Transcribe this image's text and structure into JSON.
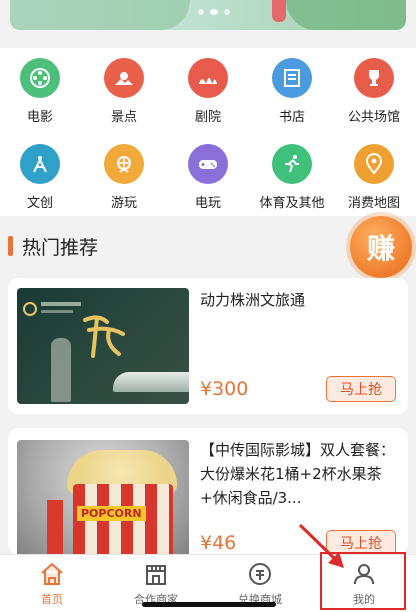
{
  "banner": {
    "page_dots": 3,
    "active_dot": 1
  },
  "categories": [
    {
      "label": "电影",
      "icon": "film-reel-icon",
      "color": "#4cc07a"
    },
    {
      "label": "景点",
      "icon": "sun-landscape-icon",
      "color": "#e8604a"
    },
    {
      "label": "剧院",
      "icon": "opera-house-icon",
      "color": "#e75a4c"
    },
    {
      "label": "书店",
      "icon": "bookstore-icon",
      "color": "#4a9be0"
    },
    {
      "label": "公共场馆",
      "icon": "trophy-icon",
      "color": "#e85c4a"
    },
    {
      "label": "文创",
      "icon": "compass-icon",
      "color": "#2fa0c8"
    },
    {
      "label": "游玩",
      "icon": "amusement-icon",
      "color": "#f0a93a"
    },
    {
      "label": "电玩",
      "icon": "gamepad-icon",
      "color": "#8a6fd8"
    },
    {
      "label": "体育及其他",
      "icon": "runner-icon",
      "color": "#40c07a"
    },
    {
      "label": "消费地图",
      "icon": "map-pin-icon",
      "color": "#f0a030"
    }
  ],
  "section": {
    "title": "热门推荐",
    "badge": "赚"
  },
  "products": [
    {
      "title": "动力株洲文旅通",
      "price": "¥300",
      "button": "马上抢"
    },
    {
      "title": "【中传国际影城】双人套餐：大份爆米花1桶+2杯水果茶+休闲食品/3...",
      "price": "¥46",
      "button": "马上抢",
      "thumb_brand": "POPCORN"
    }
  ],
  "bottom_nav": [
    {
      "label": "首页",
      "icon": "home-icon",
      "active": true
    },
    {
      "label": "合作商家",
      "icon": "store-icon",
      "active": false
    },
    {
      "label": "兑换商城",
      "icon": "exchange-icon",
      "active": false
    },
    {
      "label": "我的",
      "icon": "user-icon",
      "active": false
    }
  ],
  "colors": {
    "accent": "#e8743b",
    "highlight": "#e02a2a"
  }
}
